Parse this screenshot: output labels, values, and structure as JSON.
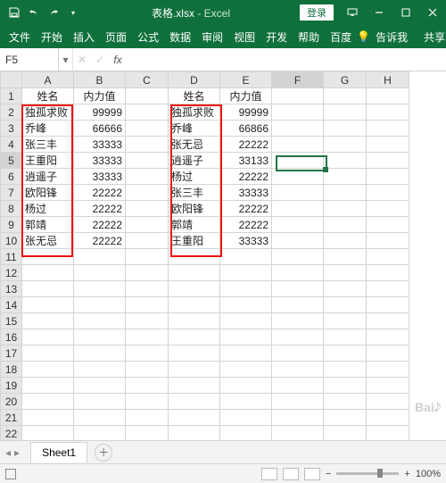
{
  "titlebar": {
    "filename": "表格.xlsx",
    "app": "Excel",
    "login": "登录"
  },
  "tabs": {
    "file": "文件",
    "home": "开始",
    "insert": "插入",
    "layout": "页面",
    "formula": "公式",
    "data": "数据",
    "review": "审阅",
    "view": "视图",
    "dev": "开发",
    "help": "帮助",
    "baidu": "百度",
    "tell": "告诉我",
    "share": "共享"
  },
  "namebox": {
    "ref": "F5"
  },
  "cols": [
    "A",
    "B",
    "C",
    "D",
    "E",
    "F",
    "G",
    "H"
  ],
  "rows": 22,
  "headers": {
    "name": "姓名",
    "power": "内力值"
  },
  "tableA": [
    {
      "name": "独孤求败",
      "val": 99999
    },
    {
      "name": "乔峰",
      "val": 66666
    },
    {
      "name": "张三丰",
      "val": 33333
    },
    {
      "name": "王重阳",
      "val": 33333
    },
    {
      "name": "逍遥子",
      "val": 33333
    },
    {
      "name": "欧阳锋",
      "val": 22222
    },
    {
      "name": "杨过",
      "val": 22222
    },
    {
      "name": "郭靖",
      "val": 22222
    },
    {
      "name": "张无忌",
      "val": 22222
    }
  ],
  "tableD": [
    {
      "name": "独孤求败",
      "val": 99999
    },
    {
      "name": "乔峰",
      "val": 66866
    },
    {
      "name": "张无忌",
      "val": 22222
    },
    {
      "name": "逍遥子",
      "val": 33133
    },
    {
      "name": "杨过",
      "val": 22222
    },
    {
      "name": "张三丰",
      "val": 33333
    },
    {
      "name": "欧阳锋",
      "val": 22222
    },
    {
      "name": "郭靖",
      "val": 22222
    },
    {
      "name": "王重阳",
      "val": 33333
    }
  ],
  "sheet": {
    "name": "Sheet1"
  },
  "status": {
    "zoom": "100%"
  },
  "colWidths": {
    "A": 58,
    "B": 58,
    "C": 48,
    "D": 58,
    "E": 58,
    "F": 58,
    "G": 48,
    "H": 48
  },
  "selection": {
    "col": "F",
    "row": 5
  }
}
